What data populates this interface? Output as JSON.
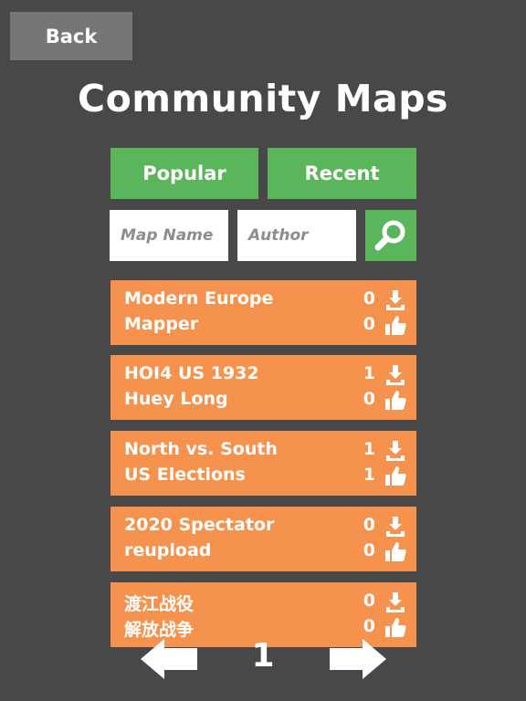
{
  "back_label": "Back",
  "title": "Community Maps",
  "tabs": {
    "popular": "Popular",
    "recent": "Recent"
  },
  "search": {
    "map_name_placeholder": "Map Name",
    "author_placeholder": "Author",
    "icon": "search-icon"
  },
  "maps": [
    {
      "line1": "Modern Europe",
      "line2": "Mapper",
      "downloads": "0",
      "likes": "0"
    },
    {
      "line1": "HOI4 US 1932",
      "line2": "Huey Long",
      "downloads": "1",
      "likes": "0"
    },
    {
      "line1": "North vs. South",
      "line2": "US Elections",
      "downloads": "1",
      "likes": "1"
    },
    {
      "line1": "2020 Spectator",
      "line2": "reupload",
      "downloads": "0",
      "likes": "0"
    },
    {
      "line1": "渡江战役",
      "line2": "解放战争",
      "downloads": "0",
      "likes": "0"
    }
  ],
  "pagination": {
    "page": "1"
  },
  "colors": {
    "background": "#484848",
    "green": "#5bb55a",
    "orange": "#f5924e",
    "back_button": "#767676"
  }
}
